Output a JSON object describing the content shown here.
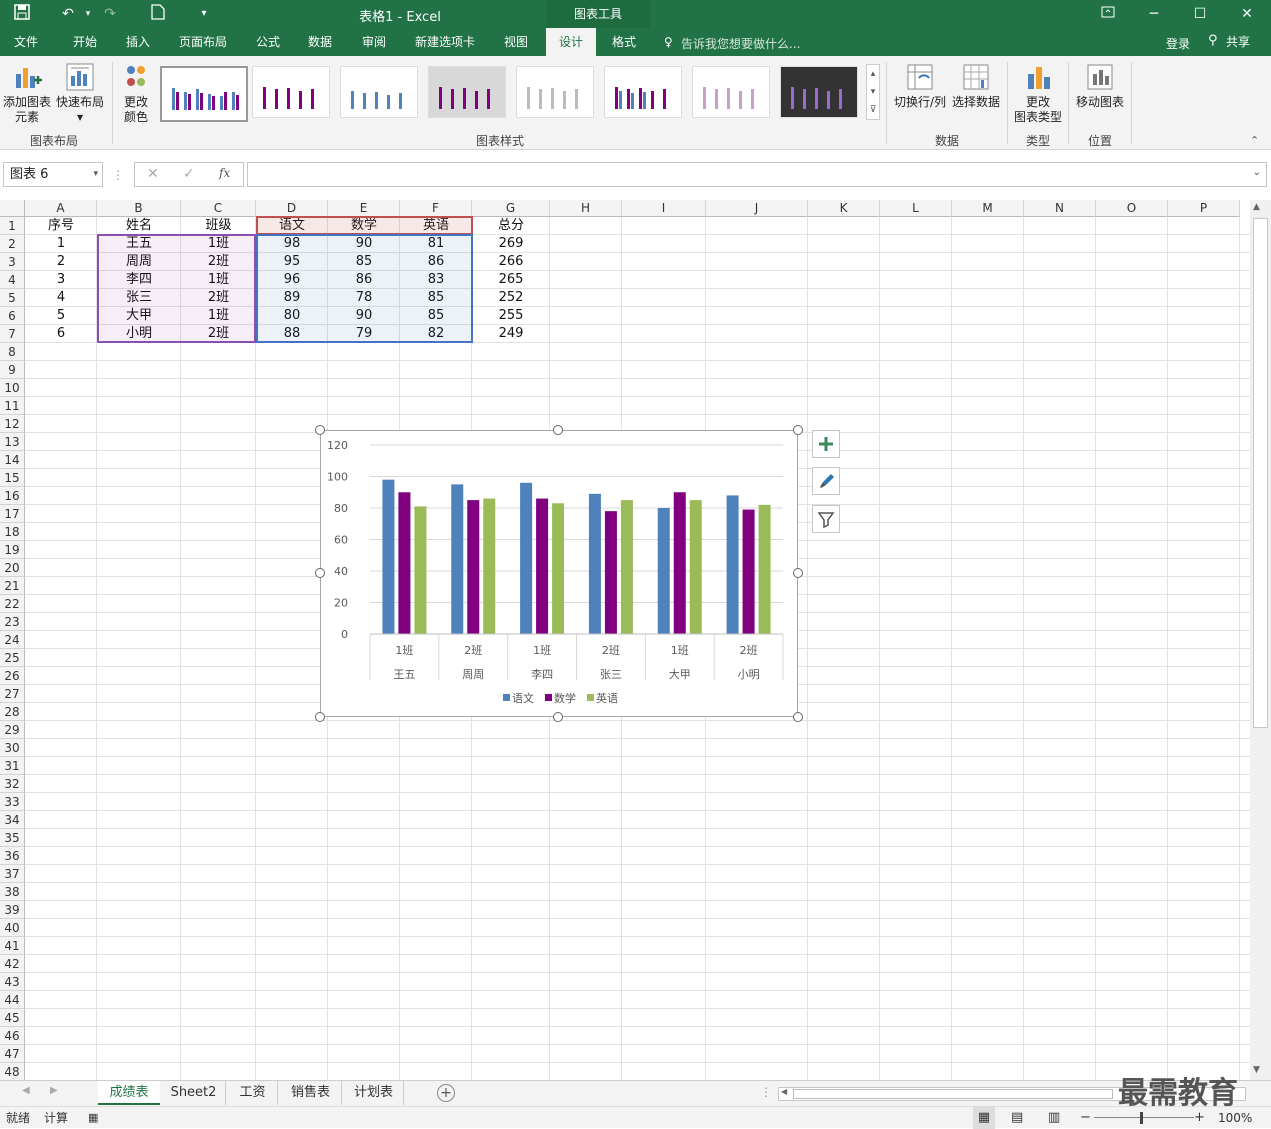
{
  "window": {
    "title": "表格1 - Excel",
    "context_tool": "图表工具",
    "login": "登录",
    "share": "共享",
    "tell_me": "告诉我您想要做什么..."
  },
  "tabs": [
    "文件",
    "开始",
    "插入",
    "页面布局",
    "公式",
    "数据",
    "审阅",
    "新建选项卡",
    "视图",
    "设计",
    "格式"
  ],
  "active_tab": "设计",
  "ribbon": {
    "add_element": "添加图表",
    "add_element2": "元素",
    "quick_layout": "快速布局",
    "change_color": "更改",
    "change_color2": "颜色",
    "group_layout": "图表布局",
    "group_styles": "图表样式",
    "switch_rowcol": "切换行/列",
    "select_data": "选择数据",
    "group_data": "数据",
    "change_type": "更改",
    "change_type2": "图表类型",
    "group_type": "类型",
    "move_chart": "移动图表",
    "group_location": "位置"
  },
  "formula_bar": {
    "name_box": "图表 6",
    "fx": "fx",
    "value": ""
  },
  "columns": [
    "A",
    "B",
    "C",
    "D",
    "E",
    "F",
    "G",
    "H",
    "I",
    "J",
    "K",
    "L",
    "M",
    "N",
    "O",
    "P"
  ],
  "rows_count": 48,
  "sheet": {
    "headers": [
      "序号",
      "姓名",
      "班级",
      "语文",
      "数学",
      "英语",
      "总分"
    ],
    "rows": [
      [
        "1",
        "王五",
        "1班",
        "98",
        "90",
        "81",
        "269"
      ],
      [
        "2",
        "周周",
        "2班",
        "95",
        "85",
        "86",
        "266"
      ],
      [
        "3",
        "李四",
        "1班",
        "96",
        "86",
        "83",
        "265"
      ],
      [
        "4",
        "张三",
        "2班",
        "89",
        "78",
        "85",
        "252"
      ],
      [
        "5",
        "大甲",
        "1班",
        "80",
        "90",
        "85",
        "255"
      ],
      [
        "6",
        "小明",
        "2班",
        "88",
        "79",
        "82",
        "249"
      ]
    ]
  },
  "chart_data": {
    "type": "bar",
    "categories": [
      [
        "1班",
        "王五"
      ],
      [
        "2班",
        "周周"
      ],
      [
        "1班",
        "李四"
      ],
      [
        "2班",
        "张三"
      ],
      [
        "1班",
        "大甲"
      ],
      [
        "2班",
        "小明"
      ]
    ],
    "series": [
      {
        "name": "语文",
        "values": [
          98,
          95,
          96,
          89,
          80,
          88
        ],
        "color": "#4f81bd"
      },
      {
        "name": "数学",
        "values": [
          90,
          85,
          86,
          78,
          90,
          79
        ],
        "color": "#800080"
      },
      {
        "name": "英语",
        "values": [
          81,
          86,
          83,
          85,
          85,
          82
        ],
        "color": "#9bbb59"
      }
    ],
    "yticks": [
      "0",
      "20",
      "40",
      "60",
      "80",
      "100",
      "120"
    ],
    "ylim": [
      0,
      120
    ],
    "title": "",
    "legend": "bottom",
    "grid": true
  },
  "sheet_tabs": [
    "成绩表",
    "Sheet2",
    "工资",
    "销售表",
    "计划表"
  ],
  "active_sheet": "成绩表",
  "status": {
    "ready": "就绪",
    "calc": "计算",
    "zoom": "100%"
  },
  "watermark": "最需教育"
}
